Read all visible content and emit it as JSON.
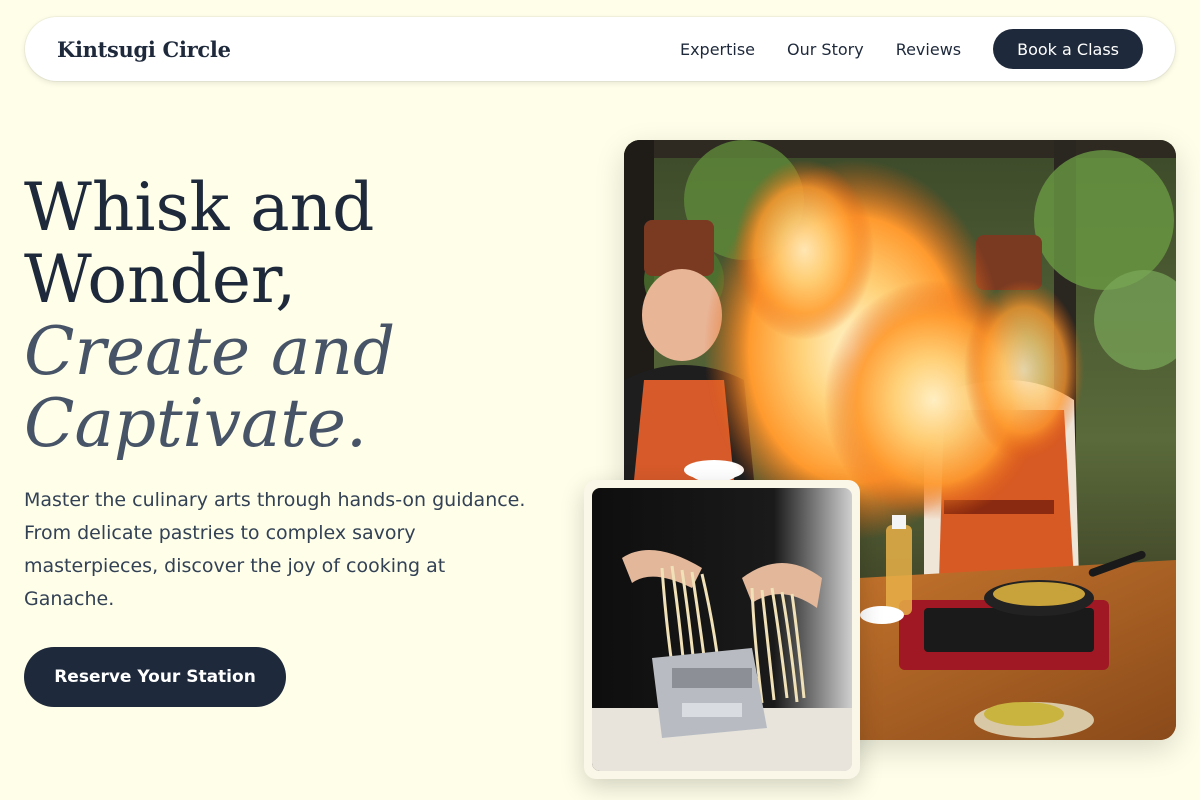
{
  "nav": {
    "brand": "Kintsugi Circle",
    "links": [
      "Expertise",
      "Our Story",
      "Reviews"
    ],
    "cta": "Book a Class"
  },
  "hero": {
    "headline_lines": [
      "Whisk and",
      "Wonder,"
    ],
    "headline_italic_lines": [
      "Create and",
      "Captivate."
    ],
    "subtext": "Master the culinary arts through hands-on guidance. From delicate pastries to complex savory masterpieces, discover the joy of cooking at Ganache.",
    "cta": "Reserve Your Station"
  },
  "colors": {
    "background": "#fefee9",
    "primary": "#1e293b",
    "italic_text": "#475467"
  },
  "images": {
    "main": "chefs-flambe-photo",
    "secondary": "fresh-pasta-photo"
  }
}
